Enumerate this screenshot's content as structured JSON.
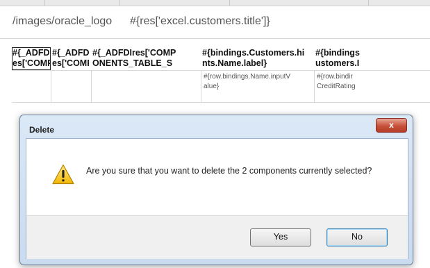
{
  "sheet": {
    "title_part1": "/images/oracle_logo",
    "title_part2": "#{res['excel.customers.title']}",
    "headers": [
      {
        "line1": "#{_ADFDIr",
        "line2": "es['COMP"
      },
      {
        "line1": "#{_ADFDIr",
        "line2": "es['COMP"
      },
      {
        "line1": "#{_ADFDIres['COMP",
        "line2": "ONENTS_TABLE_S"
      },
      {
        "line1": "#{bindings.Customers.hi",
        "line2": "nts.Name.label}"
      },
      {
        "line1": "#{bindings",
        "line2": "ustomers.I"
      }
    ],
    "row_values": [
      {
        "line1": "#{row.bindings.Name.inputV",
        "line2": "alue}"
      },
      {
        "line1": "#{row.bindir",
        "line2": "CreditRating"
      }
    ]
  },
  "dialog": {
    "title": "Delete",
    "close_label": "x",
    "message": "Are you sure that you want to delete the 2 components currently selected?",
    "yes_label": "Yes",
    "no_label": "No",
    "icon": "warning-icon"
  }
}
